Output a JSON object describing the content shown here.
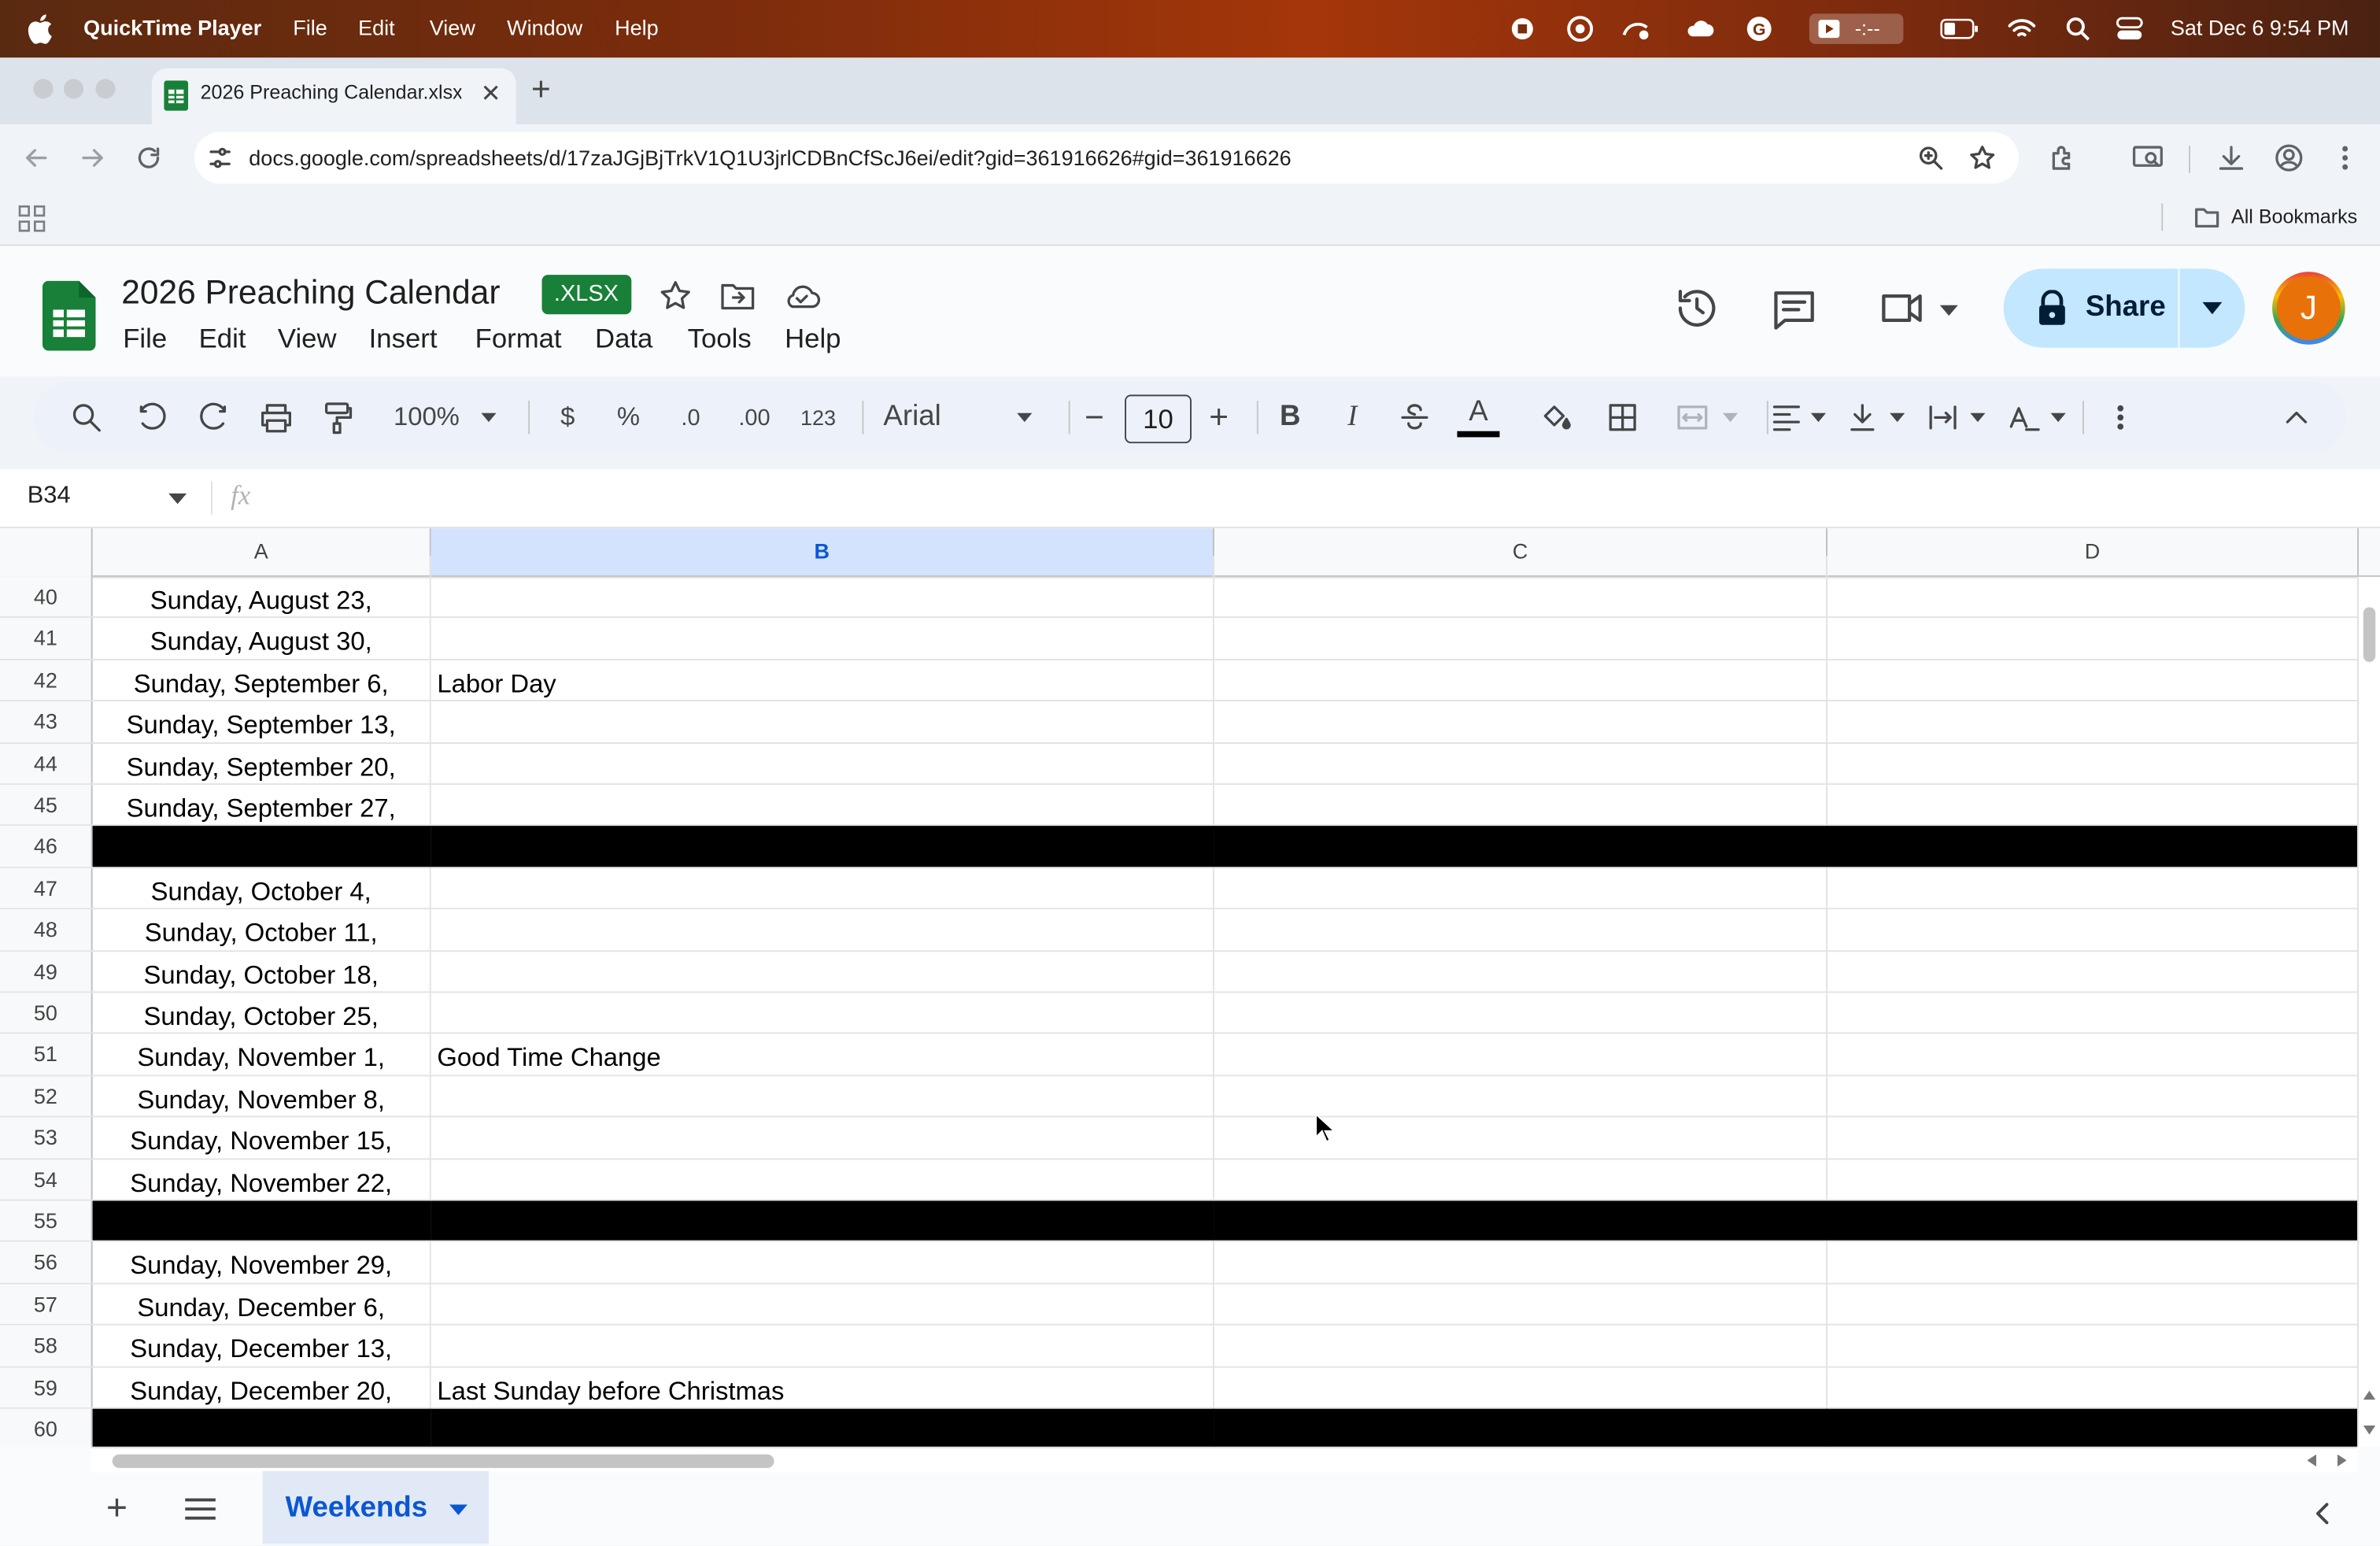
{
  "colors": {
    "accent": "#0b57d0",
    "brand_green": "#188038",
    "share_bg": "#c2e7ff",
    "avatar": "#e8710a"
  },
  "menubar": {
    "app": "QuickTime Player",
    "items": [
      "File",
      "Edit",
      "View",
      "Window",
      "Help"
    ],
    "battery_time": "-:--",
    "datetime": "Sat Dec 6  9:54 PM"
  },
  "browser": {
    "tab_title": "2026 Preaching Calendar.xlsx",
    "url": "docs.google.com/spreadsheets/d/17zaJGjBjTrkV1Q1U3jrlCDBnCfScJ6ei/edit?gid=361916626#gid=361916626",
    "bookmarks_label": "All Bookmarks"
  },
  "sheet": {
    "title": "2026 Preaching Calendar",
    "badge": ".XLSX",
    "menus": [
      "File",
      "Edit",
      "View",
      "Insert",
      "Format",
      "Data",
      "Tools",
      "Help"
    ],
    "share_label": "Share",
    "avatar_letter": "J"
  },
  "toolbar": {
    "zoom": "100%",
    "currency": "$",
    "percent": "%",
    "dec_decrease": ".0",
    "dec_increase": ".00",
    "number_format": "123",
    "font": "Arial",
    "font_size": "10",
    "bold": "B",
    "italic": "I",
    "text_color_glyph": "A"
  },
  "formula_bar": {
    "name_box": "B34",
    "fx": "fx",
    "value": ""
  },
  "grid": {
    "columns": [
      "A",
      "B",
      "C",
      "D"
    ],
    "selected_column": "B",
    "rows": [
      {
        "n": "40",
        "a": "Sunday, August 23,",
        "b": ""
      },
      {
        "n": "41",
        "a": "Sunday, August 30,",
        "b": ""
      },
      {
        "n": "42",
        "a": "Sunday, September 6,",
        "b": "Labor Day"
      },
      {
        "n": "43",
        "a": "Sunday, September 13,",
        "b": ""
      },
      {
        "n": "44",
        "a": "Sunday, September 20,",
        "b": ""
      },
      {
        "n": "45",
        "a": "Sunday, September 27,",
        "b": ""
      },
      {
        "n": "46",
        "a": "",
        "b": "",
        "black": true
      },
      {
        "n": "47",
        "a": "Sunday, October 4,",
        "b": ""
      },
      {
        "n": "48",
        "a": "Sunday, October 11,",
        "b": ""
      },
      {
        "n": "49",
        "a": "Sunday, October 18,",
        "b": ""
      },
      {
        "n": "50",
        "a": "Sunday, October 25,",
        "b": ""
      },
      {
        "n": "51",
        "a": "Sunday, November 1,",
        "b": "Good Time Change"
      },
      {
        "n": "52",
        "a": "Sunday, November 8,",
        "b": ""
      },
      {
        "n": "53",
        "a": "Sunday, November 15,",
        "b": ""
      },
      {
        "n": "54",
        "a": "Sunday, November 22,",
        "b": ""
      },
      {
        "n": "55",
        "a": "",
        "b": "",
        "black": true
      },
      {
        "n": "56",
        "a": "Sunday, November 29,",
        "b": ""
      },
      {
        "n": "57",
        "a": "Sunday, December 6,",
        "b": ""
      },
      {
        "n": "58",
        "a": "Sunday, December 13,",
        "b": ""
      },
      {
        "n": "59",
        "a": "Sunday, December 20,",
        "b": "Last Sunday before Christmas"
      },
      {
        "n": "60",
        "a": "",
        "b": "",
        "black": true
      }
    ]
  },
  "bottom": {
    "sheet_tab": "Weekends"
  }
}
